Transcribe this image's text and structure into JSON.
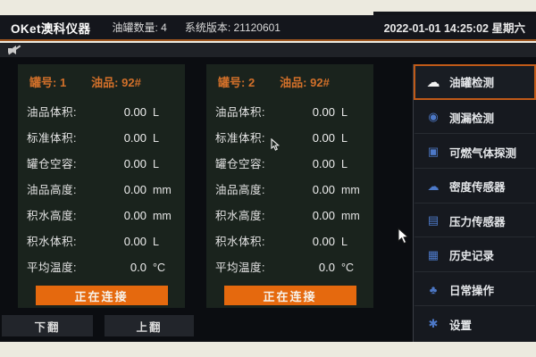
{
  "topbar": {
    "logo": "OKet澳科仪器",
    "tank_count": "油罐数量: 4",
    "version": "系统版本: 21120601",
    "datetime": "2022-01-01 14:25:02 星期六"
  },
  "tanks": [
    {
      "tank_label": "罐号: 1",
      "oil_label": "油品: 92#",
      "rows": [
        {
          "label": "油品体积:",
          "value": "0.00",
          "unit": "L"
        },
        {
          "label": "标准体积:",
          "value": "0.00",
          "unit": "L"
        },
        {
          "label": "罐仓空容:",
          "value": "0.00",
          "unit": "L"
        },
        {
          "label": "油品高度:",
          "value": "0.00",
          "unit": "mm"
        },
        {
          "label": "积水高度:",
          "value": "0.00",
          "unit": "mm"
        },
        {
          "label": "积水体积:",
          "value": "0.00",
          "unit": "L"
        },
        {
          "label": "平均温度:",
          "value": "0.0",
          "unit": "°C"
        }
      ],
      "status_button": "正在连接"
    },
    {
      "tank_label": "罐号: 2",
      "oil_label": "油品: 92#",
      "rows": [
        {
          "label": "油品体积:",
          "value": "0.00",
          "unit": "L"
        },
        {
          "label": "标准体积:",
          "value": "0.00",
          "unit": "L"
        },
        {
          "label": "罐仓空容:",
          "value": "0.00",
          "unit": "L"
        },
        {
          "label": "油品高度:",
          "value": "0.00",
          "unit": "mm"
        },
        {
          "label": "积水高度:",
          "value": "0.00",
          "unit": "mm"
        },
        {
          "label": "积水体积:",
          "value": "0.00",
          "unit": "L"
        },
        {
          "label": "平均温度:",
          "value": "0.0",
          "unit": "°C"
        }
      ],
      "status_button": "正在连接"
    }
  ],
  "pager": {
    "down_label": "下翻",
    "up_label": "上翻"
  },
  "sidebar": {
    "items": [
      {
        "label": "油罐检测",
        "icon": "tank-cloud-icon",
        "glyph": "☁",
        "active": true
      },
      {
        "label": "测漏检测",
        "icon": "leak-detect-icon",
        "glyph": "◉",
        "active": false
      },
      {
        "label": "可燃气体探测",
        "icon": "gas-detector-icon",
        "glyph": "▣",
        "active": false
      },
      {
        "label": "密度传感器",
        "icon": "density-sensor-icon",
        "glyph": "☁",
        "active": false
      },
      {
        "label": "压力传感器",
        "icon": "pressure-sensor-icon",
        "glyph": "▤",
        "active": false
      },
      {
        "label": "历史记录",
        "icon": "history-icon",
        "glyph": "▦",
        "active": false
      },
      {
        "label": "日常操作",
        "icon": "daily-ops-icon",
        "glyph": "♣",
        "active": false
      },
      {
        "label": "设置",
        "icon": "settings-gear-icon",
        "glyph": "✱",
        "active": false
      }
    ]
  },
  "colors": {
    "accent_orange": "#d2702a",
    "topbar_rule_orange": "#a0561e",
    "connect_button_orange": "#e5690e",
    "sidebar_icon_blue": "#4d79c8",
    "panel_green": "#1a231d"
  }
}
